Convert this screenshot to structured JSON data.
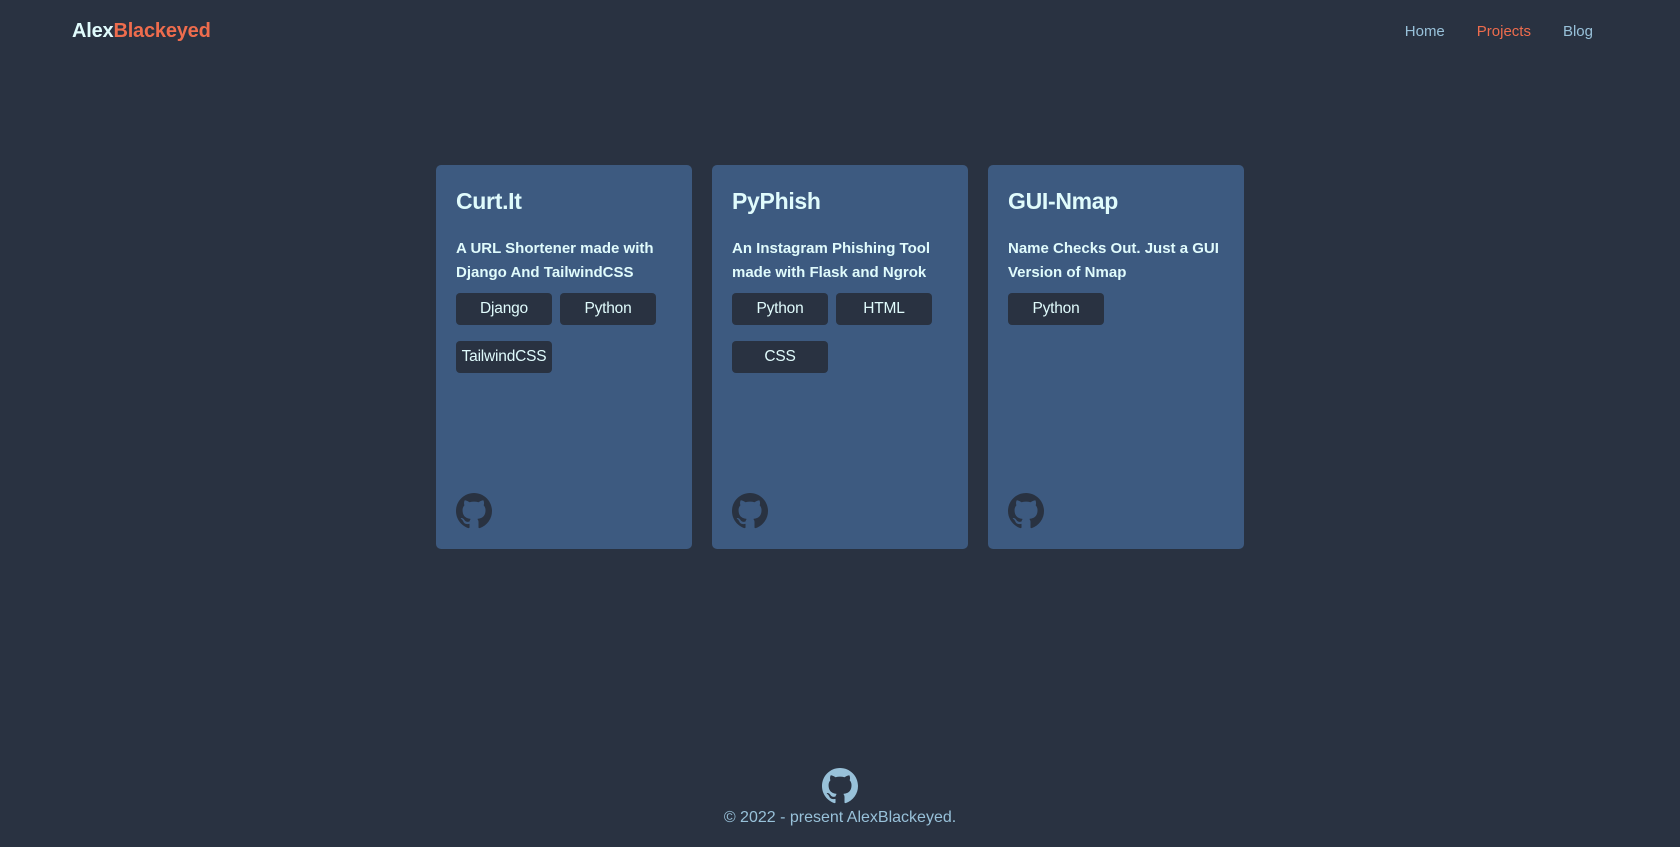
{
  "brand": {
    "first": "Alex",
    "second": "Blackeyed"
  },
  "nav": [
    {
      "label": "Home",
      "active": false
    },
    {
      "label": "Projects",
      "active": true
    },
    {
      "label": "Blog",
      "active": false
    }
  ],
  "projects": [
    {
      "title": "Curt.It",
      "description": "A URL Shortener made with Django And TailwindCSS",
      "tags": [
        "Django",
        "Python",
        "TailwindCSS"
      ],
      "icon": "github-icon"
    },
    {
      "title": "PyPhish",
      "description": "An Instagram Phishing Tool made with Flask and Ngrok",
      "tags": [
        "Python",
        "HTML",
        "CSS"
      ],
      "icon": "github-icon"
    },
    {
      "title": "GUI-Nmap",
      "description": "Name Checks Out. Just a GUI Version of Nmap",
      "tags": [
        "Python"
      ],
      "icon": "github-icon"
    }
  ],
  "footer": {
    "text": "© 2022 - present AlexBlackeyed.",
    "icon": "github-icon"
  },
  "colors": {
    "background": "#293241",
    "card": "#3d5a80",
    "accent": "#ee6c4d",
    "link": "#98c1d9",
    "text": "#e0fbfc"
  }
}
